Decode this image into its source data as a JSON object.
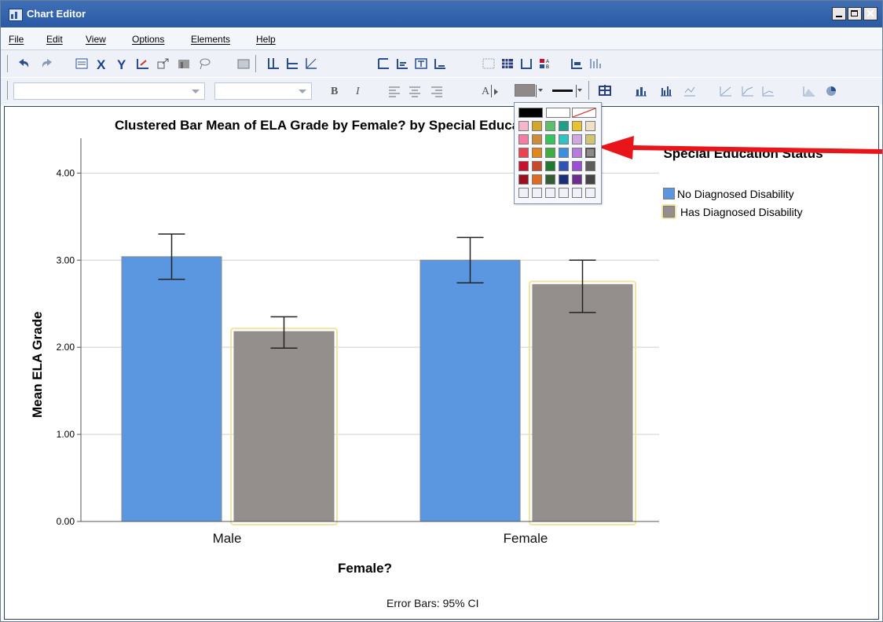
{
  "window": {
    "title": "Chart Editor"
  },
  "menu": [
    "File",
    "Edit",
    "View",
    "Options",
    "Elements",
    "Help"
  ],
  "toolbar2": {
    "bold_label": "B",
    "italic_label": "I",
    "text_label": "A"
  },
  "palette": {
    "rows": [
      [
        "#000000",
        "#ffffff",
        "none"
      ],
      [
        "#f4b6c8",
        "#d4a72c",
        "#5cbf6b",
        "#1f9e89",
        "#e7c32e",
        "#efe1c9"
      ],
      [
        "#f27ea3",
        "#cc8c3a",
        "#35c35b",
        "#2ec4c4",
        "#cfa8e2",
        "#d2c477"
      ],
      [
        "#e8434f",
        "#e0861a",
        "#3fae3f",
        "#3a8fe0",
        "#b77bdb",
        "#8f8a89"
      ],
      [
        "#c8102e",
        "#c94a2a",
        "#1f7a2e",
        "#2f54b5",
        "#9b4fd8",
        "#5d5d5d"
      ],
      [
        "#9c0f1d",
        "#e06a20",
        "#335d32",
        "#1a2f7a",
        "#6a2e91",
        "#454545"
      ],
      [
        "#eef2f8",
        "#eef2f8",
        "#eef2f8",
        "#eef2f8",
        "#eef2f8",
        "#eef2f8"
      ]
    ],
    "selected": "#8f8a89"
  },
  "chart_data": {
    "type": "bar",
    "title": "Clustered Bar Mean of ELA Grade by Female? by Special Education Status",
    "xlabel": "Female?",
    "ylabel": "Mean ELA Grade",
    "categories": [
      "Male",
      "Female"
    ],
    "ylim": [
      0,
      4.4
    ],
    "yticks": [
      "0.00",
      "1.00",
      "2.00",
      "3.00",
      "4.00"
    ],
    "legend_title": "Special Education Status",
    "legend_placement": "top-right",
    "footnote": "Error Bars: 95% CI",
    "grid": true,
    "series": [
      {
        "name": "No Diagnosed Disability",
        "color": "#5b97e0",
        "values": [
          3.04,
          3.0
        ],
        "ci_low": [
          2.78,
          2.74
        ],
        "ci_high": [
          3.3,
          3.26
        ]
      },
      {
        "name": "Has Diagnosed Disability",
        "color": "#948f8d",
        "values": [
          2.18,
          2.72
        ],
        "ci_low": [
          1.99,
          2.4
        ],
        "ci_high": [
          2.35,
          3.0
        ]
      }
    ]
  }
}
